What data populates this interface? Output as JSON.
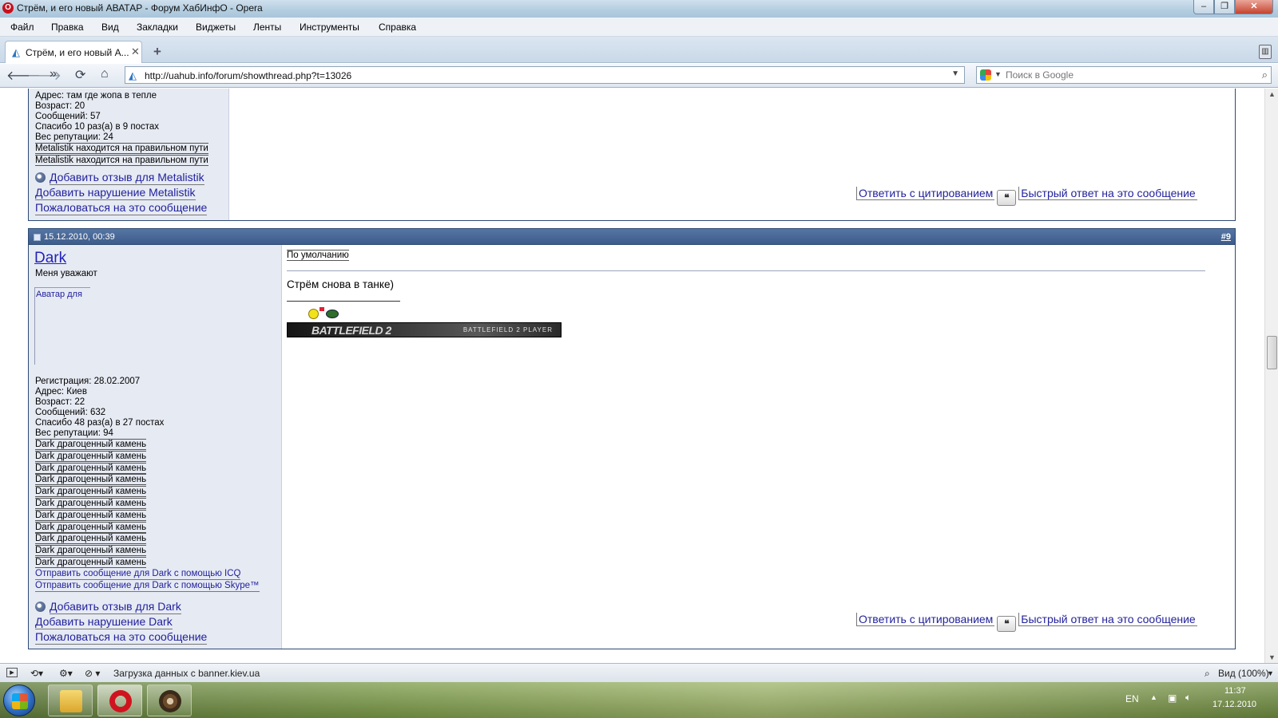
{
  "window": {
    "title": "Стрём, и его новый АВАТАР - Форум ХабИнфО - Opera",
    "minimize": "–",
    "maximize": "❐",
    "close": "✕"
  },
  "menu": [
    "Файл",
    "Правка",
    "Вид",
    "Закладки",
    "Виджеты",
    "Ленты",
    "Инструменты",
    "Справка"
  ],
  "tab": {
    "title": "Стрём, и его новый А...",
    "close": "✕",
    "new": "+"
  },
  "address": {
    "url": "http://uahub.info/forum/showthread.php?t=13026",
    "search_placeholder": "Поиск в Google"
  },
  "post_prev": {
    "info": [
      "Адрес: там где жопа в тепле",
      "Возраст: 20",
      "Сообщений: 57",
      "Спасибо 10 раз(а) в 9 постах",
      "Вес репутации: 24"
    ],
    "reputation": [
      "Metalistik находится на правильном пути",
      "Metalistik находится на правильном пути"
    ],
    "links": [
      "Добавить отзыв для Metalistik",
      "Добавить нарушение Metalistik",
      "Пожаловаться на это сообщение"
    ],
    "actions": {
      "quote": "Ответить с цитированием",
      "quick": "Быстрый ответ на это сообщение"
    }
  },
  "post": {
    "date": "15.12.2010, 00:39",
    "number": "#9",
    "username": "Dark",
    "usertitle": "Меня уважают",
    "avatar_alt": "Аватар для",
    "info": [
      "Регистрация: 28.02.2007",
      "Адрес: Киев",
      "Возраст: 22",
      "Сообщений: 632",
      "Спасибо 48 раз(а) в 27 постах",
      "Вес репутации: 94"
    ],
    "reputation": [
      "Dark драгоценный камень",
      "Dark драгоценный камень",
      "Dark драгоценный камень",
      "Dark драгоценный камень",
      "Dark драгоценный камень",
      "Dark драгоценный камень",
      "Dark драгоценный камень",
      "Dark драгоценный камень",
      "Dark драгоценный камень",
      "Dark драгоценный камень",
      "Dark драгоценный камень"
    ],
    "contact": [
      "Отправить сообщение для Dark с помощью ICQ",
      "Отправить сообщение для Dark с помощью Skype™"
    ],
    "links": [
      "Добавить отзыв для Dark",
      "Добавить нарушение Dark",
      "Пожаловаться на это сообщение"
    ],
    "icon_label": "По умолчанию",
    "message": "Стрём снова в танке)",
    "banner_left": "BATTLEFIELD 2",
    "banner_right": "BATTLEFIELD 2 PLAYER",
    "actions": {
      "quote": "Ответить с цитированием",
      "quick": "Быстрый ответ на это сообщение"
    }
  },
  "statusbar": {
    "text": "Загрузка данных с banner.kiev.ua",
    "zoom": "Вид (100%)"
  },
  "tray": {
    "lang": "EN",
    "time": "11:37",
    "date": "17.12.2010"
  }
}
